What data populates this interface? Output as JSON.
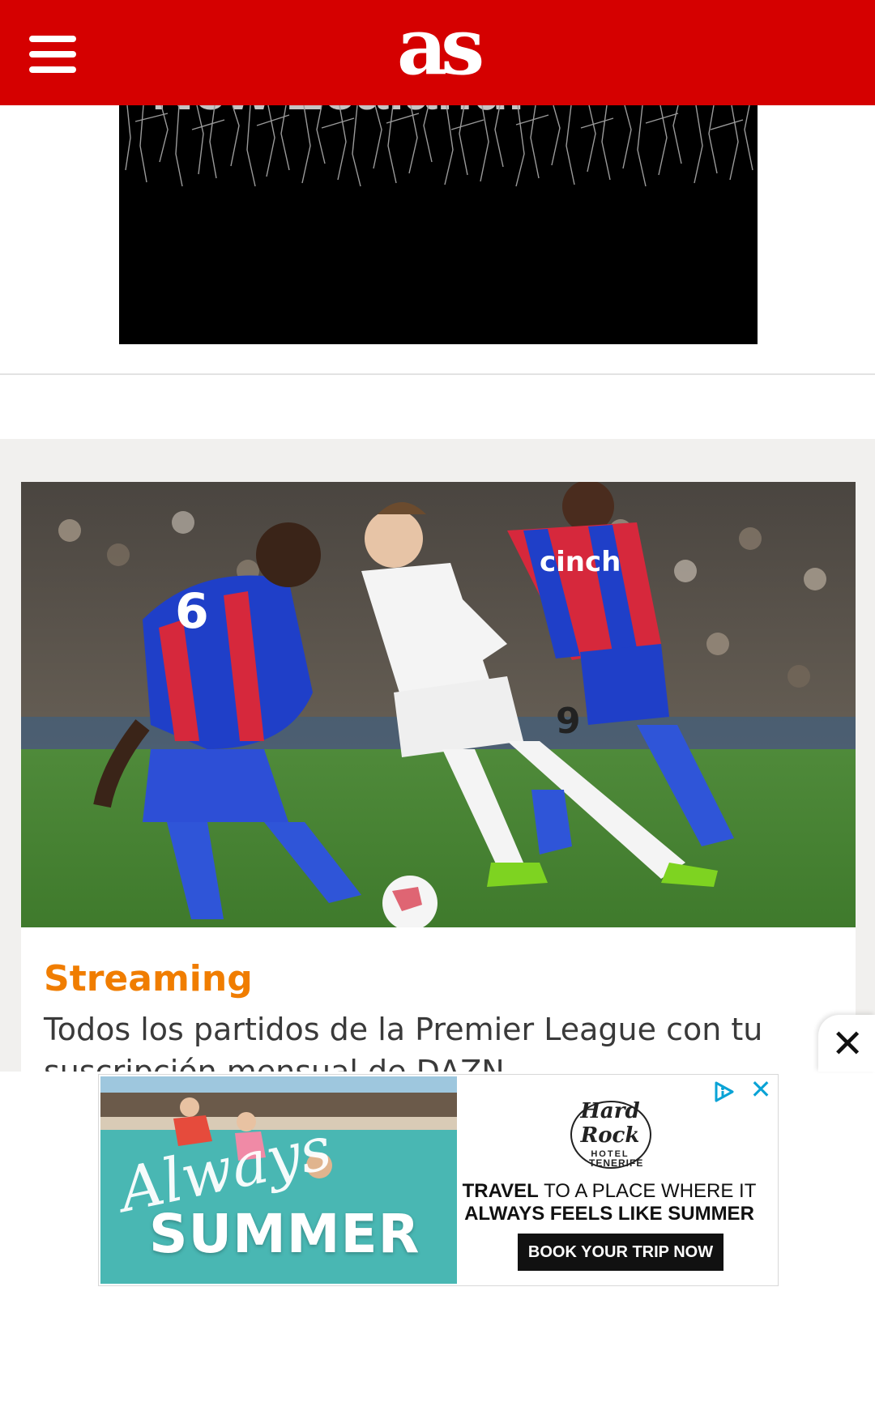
{
  "header": {
    "menu_icon": "hamburger-menu-icon",
    "logo_text": "as",
    "background": "#d50000"
  },
  "top_ad": {
    "overlay_text": "New Zealand."
  },
  "article_card": {
    "image_alt": "Football match: player in white Leeds kit number 9 dribbling past players in red and blue striped kit",
    "kicker": "Streaming",
    "kicker_color": "#f07d00",
    "title": "Todos los partidos de la Premier League con tu suscripción mensual de DAZN"
  },
  "sticky_ad": {
    "close_tab_icon": "close-icon",
    "image_text_script": "Always",
    "image_text_bold": "SUMMER",
    "brand_name": "Hard Rock",
    "brand_sub": "HOTEL",
    "brand_location": "TENERIFE",
    "tagline_bold_1": "TRAVEL",
    "tagline_1": " TO A PLACE WHERE IT",
    "tagline_bold_2": "ALWAYS FEELS LIKE SUMMER",
    "cta_label": "BOOK YOUR TRIP NOW",
    "adchoices_icon": "adchoices-icon",
    "ad_close_icon": "close-icon",
    "ad_close_symbol": "✕",
    "ad_accent_color": "#0aa3d6"
  }
}
